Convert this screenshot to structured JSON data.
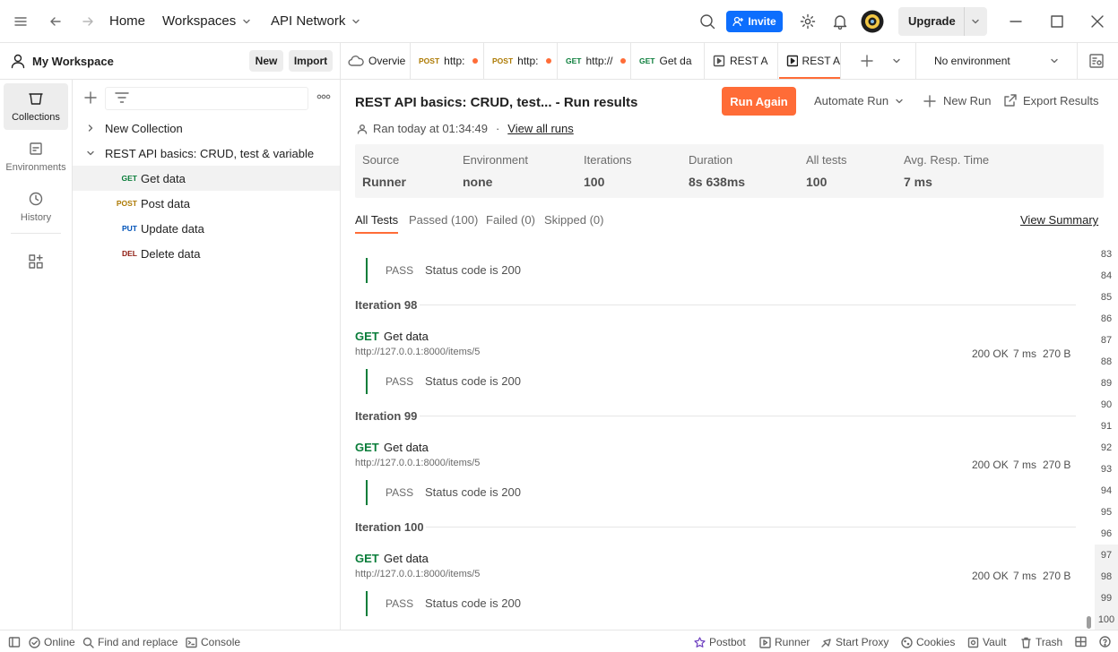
{
  "topbar": {
    "home": "Home",
    "workspaces": "Workspaces",
    "api_network": "API Network",
    "invite": "Invite",
    "upgrade": "Upgrade"
  },
  "workspace": {
    "name": "My Workspace",
    "new_label": "New",
    "import_label": "Import"
  },
  "rail": {
    "collections": "Collections",
    "environments": "Environments",
    "history": "History"
  },
  "tree": {
    "collapsed_collection": "New Collection",
    "expanded_collection": "REST API basics: CRUD, test & variable",
    "requests": [
      {
        "method": "GET",
        "name": "Get data"
      },
      {
        "method": "POST",
        "name": "Post data"
      },
      {
        "method": "PUT",
        "name": "Update data"
      },
      {
        "method": "DEL",
        "name": "Delete data"
      }
    ]
  },
  "tabs": [
    {
      "method": "",
      "label": "Overvie"
    },
    {
      "method": "POST",
      "label": "http:"
    },
    {
      "method": "POST",
      "label": "http:"
    },
    {
      "method": "GET",
      "label": "http://"
    },
    {
      "method": "GET",
      "label": "Get da"
    },
    {
      "method": "",
      "label": "REST A"
    },
    {
      "method": "",
      "label": "REST A"
    }
  ],
  "environment_select": "No environment",
  "run": {
    "title": "REST API basics: CRUD, test... - Run results",
    "ran_at": "Ran today at 01:34:49",
    "view_all_runs": "View all runs",
    "run_again": "Run Again",
    "automate_run": "Automate Run",
    "new_run": "New Run",
    "export_results": "Export Results"
  },
  "summary": [
    {
      "label": "Source",
      "value": "Runner"
    },
    {
      "label": "Environment",
      "value": "none"
    },
    {
      "label": "Iterations",
      "value": "100"
    },
    {
      "label": "Duration",
      "value": "8s 638ms"
    },
    {
      "label": "All tests",
      "value": "100"
    },
    {
      "label": "Avg. Resp. Time",
      "value": "7 ms"
    }
  ],
  "result_tabs": {
    "all": "All Tests",
    "passed": "Passed (100)",
    "failed": "Failed (0)",
    "skipped": "Skipped (0)",
    "view_summary": "View Summary"
  },
  "top_partial_test": {
    "status": "PASS",
    "name": "Status code is 200"
  },
  "iterations": [
    {
      "title": "Iteration 98",
      "method": "GET",
      "name": "Get data",
      "url": "http://127.0.0.1:8000/items/5",
      "status": "200 OK",
      "time": "7 ms",
      "size": "270 B",
      "test_status": "PASS",
      "test_name": "Status code is 200"
    },
    {
      "title": "Iteration 99",
      "method": "GET",
      "name": "Get data",
      "url": "http://127.0.0.1:8000/items/5",
      "status": "200 OK",
      "time": "7 ms",
      "size": "270 B",
      "test_status": "PASS",
      "test_name": "Status code is 200"
    },
    {
      "title": "Iteration 100",
      "method": "GET",
      "name": "Get data",
      "url": "http://127.0.0.1:8000/items/5",
      "status": "200 OK",
      "time": "7 ms",
      "size": "270 B",
      "test_status": "PASS",
      "test_name": "Status code is 200"
    }
  ],
  "gutter_numbers": [
    "83",
    "84",
    "85",
    "86",
    "87",
    "88",
    "89",
    "90",
    "91",
    "92",
    "93",
    "94",
    "95",
    "96",
    "97",
    "98",
    "99",
    "100"
  ],
  "statusbar": {
    "online": "Online",
    "find_replace": "Find and replace",
    "console": "Console",
    "postbot": "Postbot",
    "runner": "Runner",
    "start_proxy": "Start Proxy",
    "cookies": "Cookies",
    "vault": "Vault",
    "trash": "Trash"
  },
  "colors": {
    "accent": "#ff6c37",
    "invite": "#0d6efd",
    "get": "#0a7d3a",
    "post": "#ad7a03",
    "put": "#0053b8",
    "del": "#8e1a10"
  }
}
